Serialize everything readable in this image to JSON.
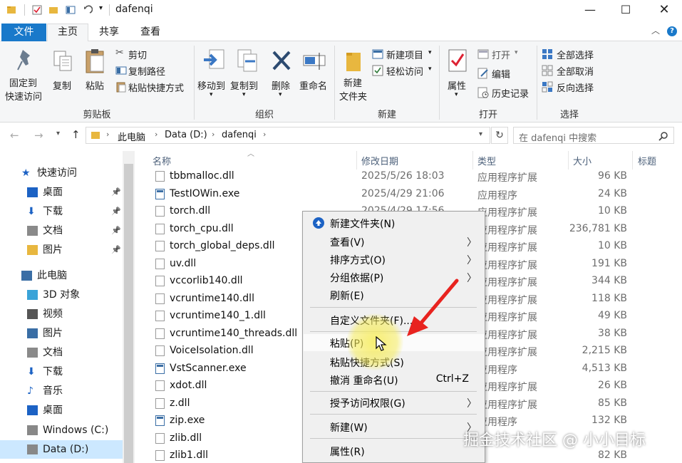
{
  "window": {
    "title": "dafenqi"
  },
  "tabs": {
    "file": "文件",
    "home": "主页",
    "share": "共享",
    "view": "查看"
  },
  "ribbon": {
    "clipboard": {
      "pin_quick": "固定到\n快速访问",
      "pin_line1": "固定到",
      "pin_line2": "快速访问",
      "copy": "复制",
      "paste": "粘贴",
      "cut": "剪切",
      "copy_path": "复制路径",
      "paste_shortcut": "粘贴快捷方式",
      "group": "剪贴板"
    },
    "organize": {
      "move_to": "移动到",
      "copy_to": "复制到",
      "delete": "删除",
      "rename": "重命名",
      "group": "组织"
    },
    "new": {
      "new_folder_line1": "新建",
      "new_folder_line2": "文件夹",
      "new_item": "新建项目",
      "easy_access": "轻松访问",
      "group": "新建"
    },
    "open": {
      "properties": "属性",
      "open": "打开",
      "edit": "编辑",
      "history": "历史记录",
      "group": "打开"
    },
    "select": {
      "select_all": "全部选择",
      "select_none": "全部取消",
      "invert": "反向选择",
      "group": "选择"
    }
  },
  "address": {
    "crumbs": [
      "此电脑",
      "Data (D:)",
      "dafenqi"
    ],
    "search_placeholder": "在 dafenqi 中搜索"
  },
  "sidebar": {
    "items": [
      {
        "label": "快速访问",
        "icon": "star-icon"
      },
      {
        "label": "桌面",
        "icon": "desktop-icon",
        "pinned": true
      },
      {
        "label": "下载",
        "icon": "download-icon",
        "pinned": true
      },
      {
        "label": "文档",
        "icon": "document-icon",
        "pinned": true
      },
      {
        "label": "图片",
        "icon": "folder-icon",
        "pinned": true
      },
      {
        "label": "此电脑",
        "icon": "computer-icon"
      },
      {
        "label": "3D 对象",
        "icon": "cube-icon"
      },
      {
        "label": "视频",
        "icon": "video-icon"
      },
      {
        "label": "图片",
        "icon": "picture-icon"
      },
      {
        "label": "文档",
        "icon": "document-icon"
      },
      {
        "label": "下载",
        "icon": "download-icon"
      },
      {
        "label": "音乐",
        "icon": "music-icon"
      },
      {
        "label": "桌面",
        "icon": "desktop-icon"
      },
      {
        "label": "Windows (C:)",
        "icon": "drive-icon"
      },
      {
        "label": "Data (D:)",
        "icon": "drive-icon",
        "selected": true
      }
    ]
  },
  "files": {
    "columns": {
      "name": "名称",
      "date": "修改日期",
      "type": "类型",
      "size": "大小",
      "tags": "标题"
    },
    "rows": [
      {
        "name": "tbbmalloc.dll",
        "date": "2025/5/26 18:03",
        "type": "应用程序扩展",
        "size": "96 KB",
        "kind": "dll"
      },
      {
        "name": "TestIOWin.exe",
        "date": "2025/4/29 21:06",
        "type": "应用程序",
        "size": "24 KB",
        "kind": "exe"
      },
      {
        "name": "torch.dll",
        "date": "2025/4/29 17:56",
        "type": "应用程序扩展",
        "size": "10 KB",
        "kind": "dll"
      },
      {
        "name": "torch_cpu.dll",
        "date": "",
        "type": "应用程序扩展",
        "size": "236,781 KB",
        "kind": "dll"
      },
      {
        "name": "torch_global_deps.dll",
        "date": "",
        "type": "应用程序扩展",
        "size": "10 KB",
        "kind": "dll"
      },
      {
        "name": "uv.dll",
        "date": "",
        "type": "应用程序扩展",
        "size": "191 KB",
        "kind": "dll"
      },
      {
        "name": "vccorlib140.dll",
        "date": "",
        "type": "应用程序扩展",
        "size": "344 KB",
        "kind": "dll"
      },
      {
        "name": "vcruntime140.dll",
        "date": "",
        "type": "应用程序扩展",
        "size": "118 KB",
        "kind": "dll"
      },
      {
        "name": "vcruntime140_1.dll",
        "date": "",
        "type": "应用程序扩展",
        "size": "49 KB",
        "kind": "dll"
      },
      {
        "name": "vcruntime140_threads.dll",
        "date": "",
        "type": "应用程序扩展",
        "size": "38 KB",
        "kind": "dll"
      },
      {
        "name": "VoiceIsolation.dll",
        "date": "",
        "type": "应用程序扩展",
        "size": "2,215 KB",
        "kind": "dll"
      },
      {
        "name": "VstScanner.exe",
        "date": "",
        "type": "应用程序",
        "size": "4,513 KB",
        "kind": "exe"
      },
      {
        "name": "xdot.dll",
        "date": "",
        "type": "应用程序扩展",
        "size": "26 KB",
        "kind": "dll"
      },
      {
        "name": "z.dll",
        "date": "",
        "type": "应用程序扩展",
        "size": "85 KB",
        "kind": "dll"
      },
      {
        "name": "zip.exe",
        "date": "",
        "type": "应用程序",
        "size": "132 KB",
        "kind": "exe"
      },
      {
        "name": "zlib.dll",
        "date": "",
        "type": "",
        "size": "",
        "kind": "dll"
      },
      {
        "name": "zlib1.dll",
        "date": "",
        "type": "",
        "size": "82 KB",
        "kind": "dll"
      }
    ]
  },
  "context_menu": {
    "new_folder": "新建文件夹(N)",
    "view": "查看(V)",
    "sort": "排序方式(O)",
    "group_by": "分组依据(P)",
    "refresh": "刷新(E)",
    "customize": "自定义文件夹(F)...",
    "paste": "粘贴(P)",
    "paste_shortcut": "粘贴快捷方式(S)",
    "undo_rename": "撤消 重命名(U)",
    "undo_shortcut": "Ctrl+Z",
    "grant_access": "授予访问权限(G)",
    "new": "新建(W)",
    "properties": "属性(R)"
  },
  "watermark": "掘金技术社区 @ 小小目标",
  "colors": {
    "accent": "#1979ca",
    "arrow": "#e8231f",
    "highlight": "#f6ec5a"
  }
}
